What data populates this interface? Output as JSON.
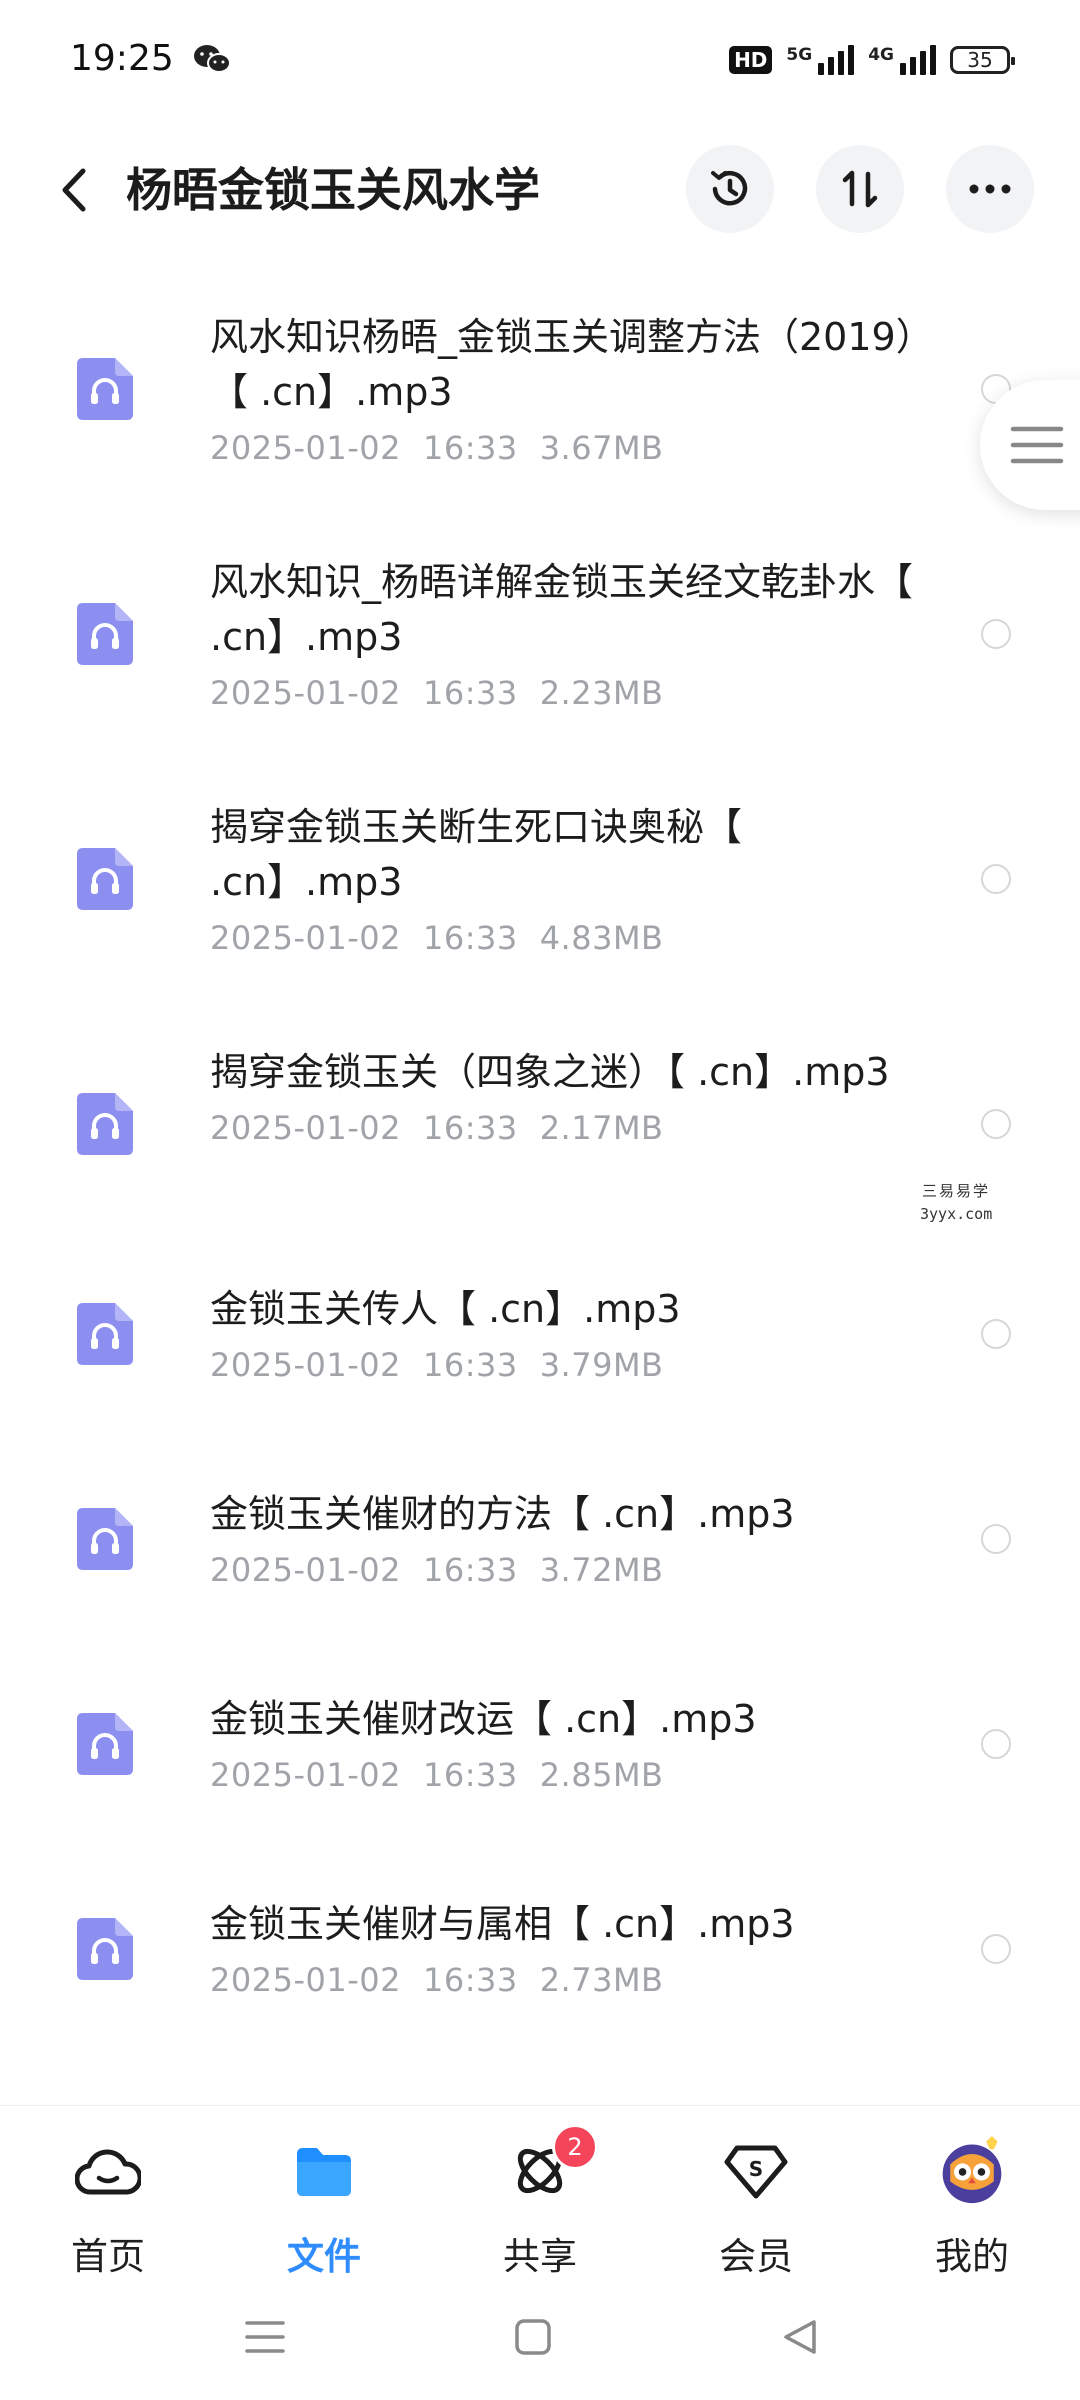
{
  "status_bar": {
    "time": "19:25",
    "hd_label": "HD",
    "network_1": "5G",
    "network_2": "4G",
    "battery": "35",
    "chat_icon": "wechat-icon"
  },
  "header": {
    "title": "杨晤金锁玉关风水学",
    "back_icon": "back-arrow-icon",
    "history_icon": "history-icon",
    "sort_icon": "sort-icon",
    "more_icon": "more-icon"
  },
  "files": [
    {
      "name": "风水知识杨晤_金锁玉关调整方法（2019）【 .cn】.mp3",
      "date": "2025-01-02",
      "time": "16:33",
      "size": "3.67MB"
    },
    {
      "name": "风水知识_杨晤详解金锁玉关经文乾卦水【 .cn】.mp3",
      "date": "2025-01-02",
      "time": "16:33",
      "size": "2.23MB"
    },
    {
      "name": "揭穿金锁玉关断生死口诀奥秘【 .cn】.mp3",
      "date": "2025-01-02",
      "time": "16:33",
      "size": "4.83MB"
    },
    {
      "name": "揭穿金锁玉关（四象之迷）【 .cn】.mp3",
      "date": "2025-01-02",
      "time": "16:33",
      "size": "2.17MB"
    },
    {
      "name": "金锁玉关传人【 .cn】.mp3",
      "date": "2025-01-02",
      "time": "16:33",
      "size": "3.79MB"
    },
    {
      "name": "金锁玉关催财的方法【 .cn】.mp3",
      "date": "2025-01-02",
      "time": "16:33",
      "size": "3.72MB"
    },
    {
      "name": "金锁玉关催财改运【 .cn】.mp3",
      "date": "2025-01-02",
      "time": "16:33",
      "size": "2.85MB"
    },
    {
      "name": "金锁玉关催财与属相【 .cn】.mp3",
      "date": "2025-01-02",
      "time": "16:33",
      "size": "2.73MB"
    }
  ],
  "watermark": {
    "line1": "三易易学",
    "line2": "3yyx.com"
  },
  "bottom_nav": [
    {
      "label": "首页",
      "icon": "cloud-home-icon",
      "active": false
    },
    {
      "label": "文件",
      "icon": "folder-icon",
      "active": true
    },
    {
      "label": "共享",
      "icon": "share-orbit-icon",
      "active": false,
      "badge": "2"
    },
    {
      "label": "会员",
      "icon": "vip-diamond-icon",
      "active": false
    },
    {
      "label": "我的",
      "icon": "owl-avatar-icon",
      "active": false
    }
  ],
  "system_nav": {
    "menu_icon": "recent-apps-icon",
    "home_icon": "home-square-icon",
    "back_icon": "back-triangle-icon"
  },
  "colors": {
    "accent": "#2f8cff",
    "file_icon": "#8c8ef0",
    "meta_text": "#a0a3a8",
    "badge": "#f4455b"
  }
}
